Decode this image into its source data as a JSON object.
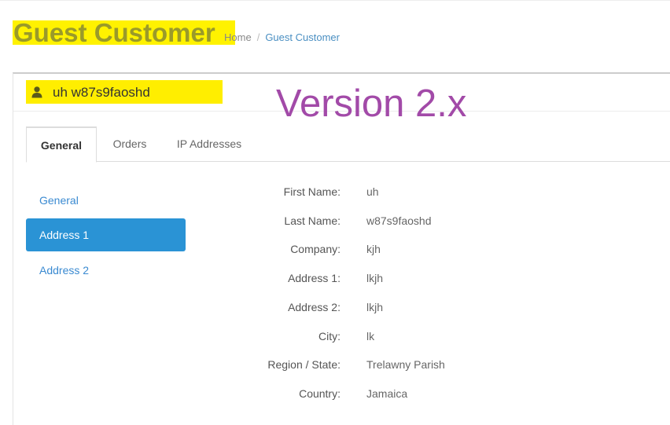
{
  "header": {
    "title": "Guest Customer",
    "breadcrumb": {
      "home": "Home",
      "separator": "/",
      "current": "Guest Customer"
    }
  },
  "panel": {
    "user_icon": "user-icon",
    "customer_name": "uh w87s9faoshd",
    "watermark": "Version 2.x"
  },
  "tabs": [
    {
      "label": "General",
      "active": true
    },
    {
      "label": "Orders",
      "active": false
    },
    {
      "label": "IP Addresses",
      "active": false
    }
  ],
  "subnav": [
    {
      "label": "General",
      "active": false
    },
    {
      "label": "Address 1",
      "active": true
    },
    {
      "label": "Address 2",
      "active": false
    }
  ],
  "fields": [
    {
      "label": "First Name:",
      "value": "uh"
    },
    {
      "label": "Last Name:",
      "value": "w87s9faoshd"
    },
    {
      "label": "Company:",
      "value": "kjh"
    },
    {
      "label": "Address 1:",
      "value": "lkjh"
    },
    {
      "label": "Address 2:",
      "value": "lkjh"
    },
    {
      "label": "City:",
      "value": "lk"
    },
    {
      "label": "Region / State:",
      "value": "Trelawny Parish"
    },
    {
      "label": "Country:",
      "value": "Jamaica"
    }
  ],
  "colors": {
    "highlight": "#ffee00",
    "accent": "#2a93d5",
    "link": "#3a8ad1",
    "watermark": "#a24aa8"
  }
}
